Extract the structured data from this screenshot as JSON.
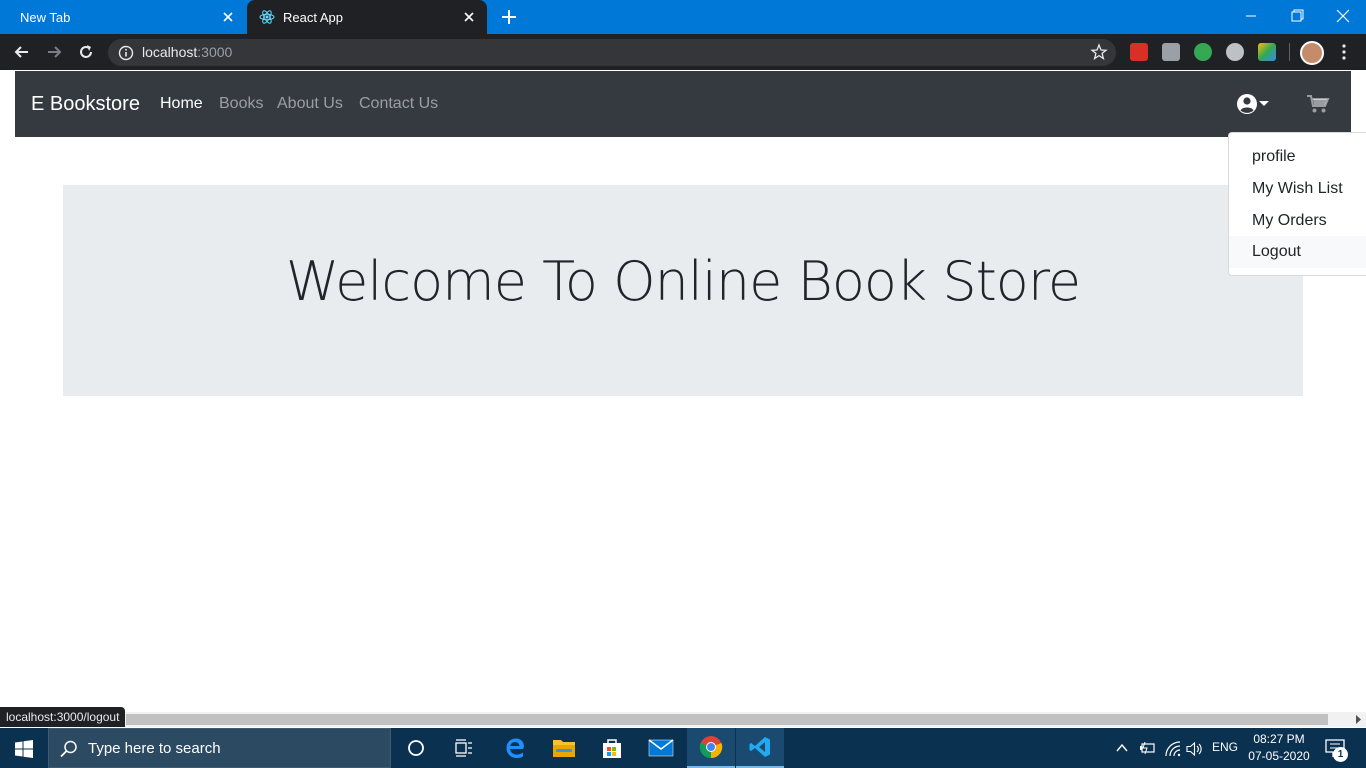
{
  "browser": {
    "tabs": [
      {
        "label": "New Tab"
      },
      {
        "label": "React App"
      }
    ],
    "url_host": "localhost",
    "url_port": ":3000",
    "status_url": "localhost:3000/logout"
  },
  "navbar": {
    "brand": "E Bookstore",
    "links": [
      {
        "label": "Home",
        "active": true
      },
      {
        "label": "Books"
      },
      {
        "label": "About Us"
      },
      {
        "label": "Contact Us"
      }
    ]
  },
  "user_menu": {
    "items": [
      {
        "label": "profile"
      },
      {
        "label": "My Wish List"
      },
      {
        "label": "My Orders"
      },
      {
        "label": "Logout",
        "hovered": true
      }
    ]
  },
  "hero": {
    "title": "Welcome To Online Book Store"
  },
  "taskbar": {
    "search_placeholder": "Type here to search",
    "language": "ENG",
    "time": "08:27 PM",
    "date": "07-05-2020",
    "notification_count": "1"
  },
  "colors": {
    "tab_strip": "#0078d7",
    "navbar": "#343a40",
    "jumbotron": "#e9ecef",
    "taskbar": "#0b3150"
  }
}
